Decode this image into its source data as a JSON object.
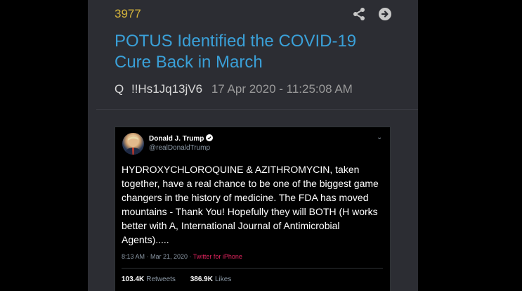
{
  "post": {
    "number": "3977",
    "title": "POTUS Identified the COVID-19 Cure Back in March",
    "author": "Q",
    "tripcode": "!!Hs1Jq13jV6",
    "timestamp": "17 Apr 2020 - 11:25:08 AM",
    "icons": {
      "share": "share-icon",
      "open": "arrow-right-circle-icon"
    }
  },
  "tweet": {
    "display_name": "Donald J. Trump",
    "handle": "@realDonaldTrump",
    "text": "HYDROXYCHLOROQUINE & AZITHROMYCIN, taken together, have a real chance to be one of the biggest game changers in the history of medicine. The FDA has moved mountains - Thank You! Hopefully they will BOTH (H works better with A, International Journal of Antimicrobial Agents).....",
    "time": "8:13 AM · Mar 21, 2020 ·",
    "source": "Twitter for iPhone",
    "retweets_count": "103.4K",
    "retweets_label": "Retweets",
    "likes_count": "386.9K",
    "likes_label": "Likes"
  },
  "colors": {
    "card_bg": "#2c2d33",
    "post_number": "#d4b33c",
    "title": "#3aa0d8",
    "source_link": "#e0245e"
  }
}
